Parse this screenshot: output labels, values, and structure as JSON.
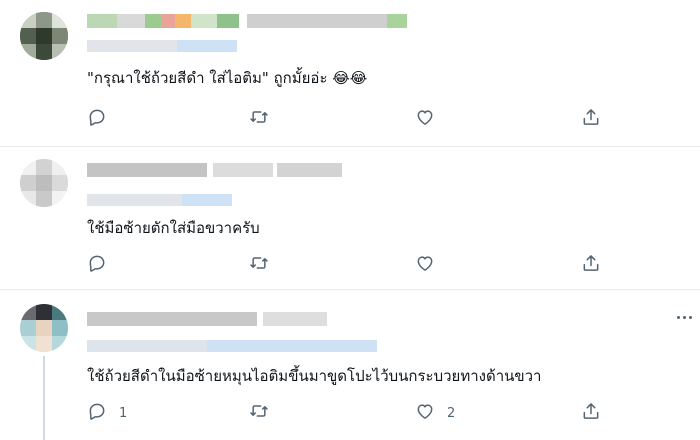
{
  "replies": [
    {
      "text": "\"กรุณาใช้ถ้วยสีดำ ใส่ไอติม\" ถูกมั้ยอ่ะ 😂😂",
      "actions": {
        "reply_count": "",
        "like_count": ""
      }
    },
    {
      "text": "ใช้มือซ้ายตักใส่มือขวาครับ",
      "actions": {
        "reply_count": "",
        "like_count": ""
      }
    },
    {
      "text": "ใช้ถ้วยสีดำในมือซ้ายหมุนไอติมขึ้นมาขูดโปะไว้บนกระบวยทางด้านขวา",
      "actions": {
        "reply_count": "1",
        "like_count": "2"
      }
    }
  ],
  "icons": {
    "reply": "reply-icon",
    "retweet": "retweet-icon",
    "like": "like-icon",
    "share": "share-icon",
    "more": "more-icon"
  },
  "colors": {
    "icon": "#536471",
    "text": "#0f1419",
    "divider": "#e6ecf0",
    "thread_line": "#cfd9de"
  }
}
